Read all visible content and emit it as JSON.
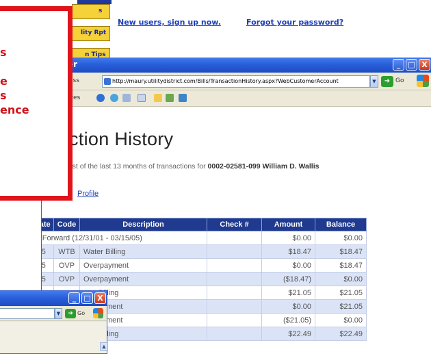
{
  "background_page": {
    "tabs": [
      "s",
      "lity Rpt",
      "n Tips"
    ],
    "signup_link": "New users, sign up now.",
    "forgot_link": "Forgot your password?"
  },
  "browser": {
    "title_fragment": "er",
    "address_label": "ess",
    "url": "http://maury.utilitydistrict.com/Bills/TransactionHistory.aspx?WebCustomerAccount",
    "go_label": "Go",
    "links_label": "ites",
    "window_buttons": [
      "_",
      "□",
      "X"
    ]
  },
  "page": {
    "heading": "ction History",
    "intro_prefix": "list of the last 13 months of transactions for ",
    "account_number": "0002-02581-099",
    "customer_name": "William D. Wallis",
    "profile_link": "Profile"
  },
  "table": {
    "headers": [
      "Trans Date",
      "Code",
      "Description",
      "Check #",
      "Amount",
      "Balance"
    ],
    "forward_row": {
      "label": "Balance Forward (12/31/01 - 03/15/05)",
      "amount": "$0.00",
      "balance": "$0.00"
    },
    "rows": [
      {
        "date": "03/15/05",
        "code": "WTB",
        "desc": "Water Billing",
        "check": "",
        "amount": "$18.47",
        "balance": "$18.47"
      },
      {
        "date": "03/15/05",
        "code": "OVP",
        "desc": "Overpayment",
        "check": "",
        "amount": "$0.00",
        "balance": "$18.47"
      },
      {
        "date": "03/15/05",
        "code": "OVP",
        "desc": "Overpayment",
        "check": "",
        "amount": "($18.47)",
        "balance": "$0.00"
      },
      {
        "date": "",
        "code": "",
        "desc": "ater Billing",
        "check": "",
        "amount": "$21.05",
        "balance": "$21.05"
      },
      {
        "date": "",
        "code": "",
        "desc": "verpayment",
        "check": "",
        "amount": "$0.00",
        "balance": "$21.05"
      },
      {
        "date": "",
        "code": "",
        "desc": "verpayment",
        "check": "",
        "amount": "($21.05)",
        "balance": "$0.00"
      },
      {
        "date": "",
        "code": "",
        "desc": "ater Billing",
        "check": "",
        "amount": "$22.49",
        "balance": "$22.49"
      }
    ]
  },
  "browser2": {
    "go_label": "Go",
    "window_buttons": [
      "_",
      "□",
      "X"
    ]
  },
  "callout": {
    "lines": [
      "s",
      "",
      "e",
      "s",
      "ence"
    ]
  },
  "colors": {
    "callout_red": "#e0141b",
    "table_header": "#1f3a8f",
    "row_stripe": "#dbe4f7",
    "xp_title_blue": "#2a5fd9",
    "tab_yellow": "#f5d13a"
  }
}
